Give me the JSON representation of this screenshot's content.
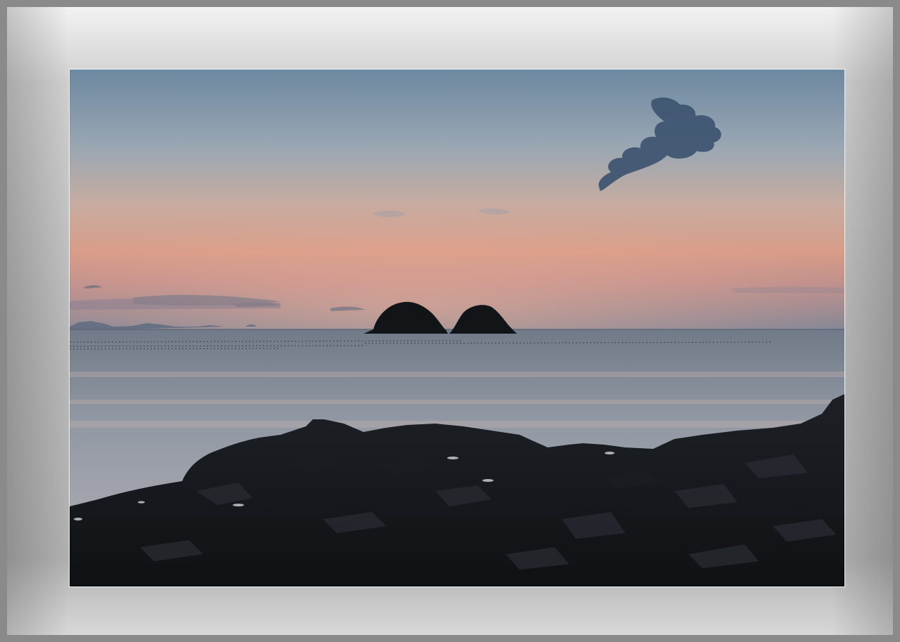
{
  "scene": {
    "subject": "sunset-seascape",
    "colors": {
      "frame_light": "#f2f2f2",
      "frame_dark": "#8a8a8a",
      "sky_top": "#6f8aa3",
      "sky_mid": "#b8a9a3",
      "sky_horizon": "#d79b8a",
      "sea": "#8d97a3",
      "rocks": "#15181c",
      "island": "#111417",
      "cloud": "#3f5670"
    }
  }
}
